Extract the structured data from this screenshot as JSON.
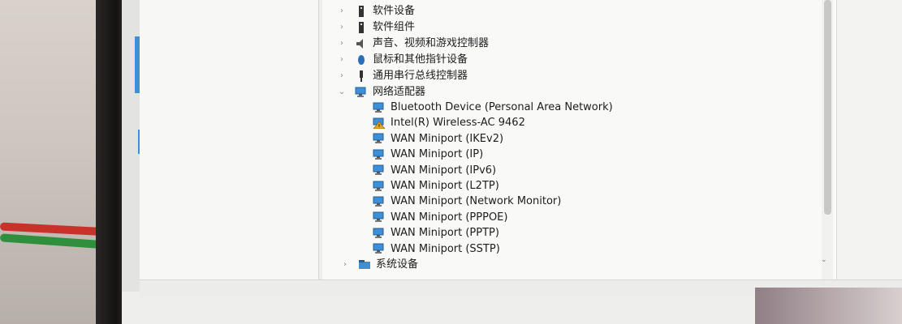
{
  "device_manager": {
    "categories": [
      {
        "label": "软件设备",
        "icon": "software-device-icon",
        "expanded": false
      },
      {
        "label": "软件组件",
        "icon": "software-component-icon",
        "expanded": false
      },
      {
        "label": "声音、视频和游戏控制器",
        "icon": "speaker-icon",
        "expanded": false
      },
      {
        "label": "鼠标和其他指针设备",
        "icon": "mouse-icon",
        "expanded": false
      },
      {
        "label": "通用串行总线控制器",
        "icon": "usb-icon",
        "expanded": false
      },
      {
        "label": "网络适配器",
        "icon": "network-adapter-icon",
        "expanded": true
      }
    ],
    "network_adapters": [
      {
        "label": "Bluetooth Device (Personal Area Network)",
        "icon": "network-adapter-icon",
        "warning": false
      },
      {
        "label": "Intel(R) Wireless-AC 9462",
        "icon": "network-adapter-warning-icon",
        "warning": true
      },
      {
        "label": "WAN Miniport (IKEv2)",
        "icon": "network-adapter-icon",
        "warning": false
      },
      {
        "label": "WAN Miniport (IP)",
        "icon": "network-adapter-icon",
        "warning": false
      },
      {
        "label": "WAN Miniport (IPv6)",
        "icon": "network-adapter-icon",
        "warning": false
      },
      {
        "label": "WAN Miniport (L2TP)",
        "icon": "network-adapter-icon",
        "warning": false
      },
      {
        "label": "WAN Miniport (Network Monitor)",
        "icon": "network-adapter-icon",
        "warning": false
      },
      {
        "label": "WAN Miniport (PPPOE)",
        "icon": "network-adapter-icon",
        "warning": false
      },
      {
        "label": "WAN Miniport (PPTP)",
        "icon": "network-adapter-icon",
        "warning": false
      },
      {
        "label": "WAN Miniport (SSTP)",
        "icon": "network-adapter-icon",
        "warning": false
      }
    ],
    "after": {
      "label": "系统设备",
      "icon": "system-device-icon",
      "expanded": false
    }
  },
  "colors": {
    "accent": "#3d8fd6",
    "warning": "#e8a317"
  }
}
